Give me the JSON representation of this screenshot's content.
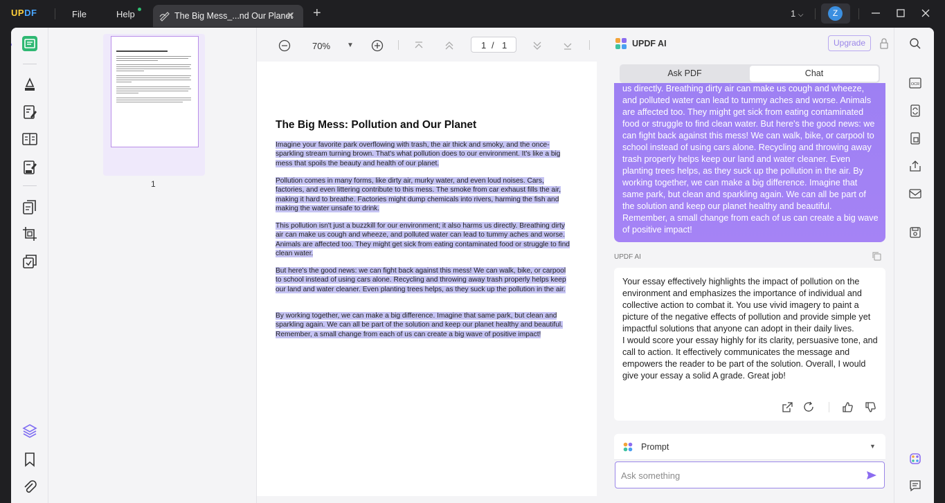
{
  "app": {
    "logo_a": "UP",
    "logo_b": "DF"
  },
  "menu": {
    "file": "File",
    "help": "Help"
  },
  "tab": {
    "title": "The Big Mess_...nd Our Planet"
  },
  "window": {
    "page_count": "1",
    "avatar_letter": "Z"
  },
  "toolbar": {
    "zoom": "70%",
    "current_page": "1",
    "page_sep": "/",
    "total_pages": "1"
  },
  "thumbnails": {
    "page_label": "1"
  },
  "document": {
    "title": "The Big Mess: Pollution and Our Planet",
    "paragraphs": [
      "Imagine your favorite park overflowing with trash, the air thick and smoky, and the once-sparkling stream turning brown. That's what pollution does to our environment. It's like a big mess that spoils the beauty and health of our planet.",
      "Pollution comes in many forms, like dirty air, murky water, and even loud noises. Cars, factories, and even littering contribute to this mess. The smoke from car exhaust fills the air, making it hard to breathe. Factories might dump chemicals into rivers, harming the fish and making the water unsafe to drink.",
      "This pollution isn't just a buzzkill for our environment; it also harms us directly. Breathing dirty air can make us cough and wheeze, and polluted water can lead to tummy aches and worse. Animals are affected too. They might get sick from eating contaminated food or struggle to find clean water.",
      "But here's the good news: we can fight back against this mess! We can walk, bike, or carpool to school instead of using cars alone. Recycling and throwing away trash properly helps keep our land and water cleaner. Even planting trees helps, as they suck up the pollution in the air.",
      "By working together, we can make a big difference. Imagine that same park, but clean and sparkling again. We can all be part of the solution and keep our planet healthy and beautiful. Remember, a small change from each of us can create a big wave of positive impact!"
    ]
  },
  "ai": {
    "title": "UPDF AI",
    "upgrade": "Upgrade",
    "tab_ask_pdf": "Ask PDF",
    "tab_chat": "Chat",
    "user_message": "us directly. Breathing dirty air can make us cough and wheeze, and polluted water can lead to tummy aches and worse. Animals are affected too. They might get sick from eating contaminated food or struggle to find clean water. But here's the good news: we can fight back against this mess! We can walk, bike, or carpool to school instead of using cars alone. Recycling and throwing away trash properly helps keep our land and water cleaner. Even planting trees helps, as they suck up the pollution in the air. By working together, we can make a big difference. Imagine that same park, but clean and sparkling again. We can all be part of the solution and keep our planet healthy and beautiful. Remember, a small change from each of us can create a big wave of positive impact!",
    "response_label": "UPDF AI",
    "response": "Your essay effectively highlights the impact of pollution on the environment and emphasizes the importance of individual and collective action to combat it. You use vivid imagery to paint a picture of the negative effects of pollution and provide simple yet impactful solutions that anyone can adopt in their daily lives.\nI would score your essay highly for its clarity, persuasive tone, and call to action. It effectively communicates the message and empowers the reader to be part of the solution. Overall, I would give your essay a solid A grade. Great job!",
    "prompt_label": "Prompt",
    "input_placeholder": "Ask something"
  },
  "colors": {
    "accent": "#8b6cf0",
    "highlight": "#c5c3f3",
    "chrome": "#1f1f22"
  }
}
